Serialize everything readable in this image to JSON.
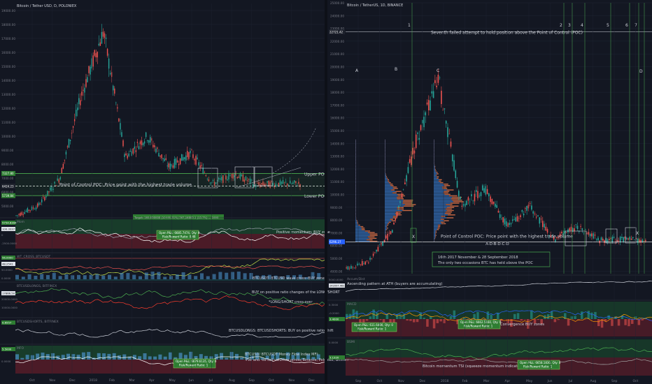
{
  "left": {
    "header": "Bitcoin / Tether USD, D, POLONIEX",
    "y_ticks": [
      "19000.00",
      "18000.00",
      "17000.00",
      "16000.00",
      "15000.00",
      "14000.00",
      "13000.00",
      "12000.00",
      "11000.00",
      "10000.00",
      "9000.00",
      "8000.00",
      "7000.00",
      "6000.00",
      "5000.00"
    ],
    "y_tick_values": [
      19000,
      18000,
      17000,
      16000,
      15000,
      14000,
      13000,
      12000,
      11000,
      10000,
      9000,
      8000,
      7000,
      6000,
      5000
    ],
    "price_tags": [
      {
        "text": "7327.80",
        "color": "#2e7d32"
      },
      {
        "text": "6424.23",
        "color": "#1e222d"
      },
      {
        "text": "5739.84",
        "color": "#2e7d32"
      }
    ],
    "labels": {
      "upper_poc": "Upper POC",
      "poc": "Point of Control POC: Price point with the highest trade volume",
      "lower_poc": "Lower POC",
      "target": "Target: 169.538088 (10445.31%) 367,16883.1 (13.7%) ... 1990"
    },
    "panes": [
      {
        "title": "Mom",
        "readout": "100.3337",
        "tag": "5754.6394",
        "side": "Positive momentum: BUY zone",
        "ticks": [
          "0",
          "-2500.0000"
        ],
        "pnl": [
          "Open P&L: 6685.7474, Qty: 0",
          "Risk/Reward Ratio: 0.48"
        ]
      },
      {
        "title": "WT_CROSS_BTCUSDT",
        "readout": "48.2541",
        "tag": "56.0000",
        "side": "BTCUSDT: BTCUSD wave cross: BUY zone",
        "ticks": [
          "50.0000",
          "0.0000"
        ]
      },
      {
        "title": "BTCUSDLONGS, BITFINEX",
        "readout": "17866.50",
        "tag": "",
        "side": "BUY on positive ratio changes of the LONG/SHORT",
        "side2": "*LONG/SHORT cross over",
        "ticks": [
          "20000.0000",
          "10000.0000"
        ]
      },
      {
        "title": "BTCUSDSHORTS, BITFINEX",
        "readout": "",
        "tag": "0.6557",
        "side": "BTCUSDLONGS: BTCUSDSHORTS: BUY on positive ratio shift",
        "ticks": []
      },
      {
        "title": "MFO",
        "readout": "",
        "tag": "5.5000",
        "side": "BTCUSD/ BTCUSDT Money Flow Index MFI:",
        "side2": "+ve and -ve sell volumes across Binance, Poloniex, Bitfinex",
        "ticks": [
          "0.0000"
        ],
        "pnl": [
          "Open P&L: 6679.6135, Qty: 0",
          "Risk/Reward Ratio: 1"
        ]
      }
    ],
    "x_ticks": [
      "Oct",
      "Nov",
      "Dec",
      "2018",
      "Feb",
      "Mar",
      "Apr",
      "May",
      "Jun",
      "Jul",
      "Aug",
      "Sep",
      "Oct",
      "Nov",
      "Dec"
    ]
  },
  "right": {
    "header": "Bitcoin / TetherUS, 1D, BINANCE",
    "y_ticks": [
      "25000.00",
      "24000.00",
      "23000.00",
      "22000.00",
      "21000.00",
      "20000.00",
      "19000.00",
      "18000.00",
      "17000.00",
      "16000.00",
      "15000.00",
      "14000.00",
      "13000.00",
      "12000.00",
      "11000.00",
      "10000.00",
      "9000.00",
      "8000.00",
      "7000.00",
      "6000.00",
      "5000.00",
      "4000.00"
    ],
    "y_tick_values": [
      25000,
      24000,
      23000,
      22000,
      21000,
      20000,
      19000,
      18000,
      17000,
      16000,
      15000,
      14000,
      13000,
      12000,
      11000,
      10000,
      9000,
      8000,
      7000,
      6000,
      5000,
      4000
    ],
    "price_tags": [
      {
        "text": "22721.42",
        "color": "#1e222d"
      },
      {
        "text": "6296.27",
        "color": "#2962ff"
      }
    ],
    "markers": [
      "1",
      "2",
      "3",
      "4",
      "5",
      "6",
      "7"
    ],
    "letters": [
      "A",
      "B",
      "C",
      "D"
    ],
    "x_labels": {
      "bottom": "A-D-B-D-C-D",
      "box_x1": "X",
      "box_x2": "X"
    },
    "labels": {
      "seventh": "Seventh failed attempt to hold position above the Point of Control (POC)",
      "poc": "Point of Control POC: Price point with the highest trade volume",
      "note1": "16th 2017 November & 28 September 2018",
      "note2": "The only two occasions BTC has held above the POC"
    },
    "panes": [
      {
        "title": "Accum/Dist",
        "readout": "242097.4611",
        "tag": "",
        "side": "Ascending pattern at ATH (buyers are accumulating)",
        "ticks": [
          "5000.0000"
        ]
      },
      {
        "title": "MACD",
        "readout": "",
        "tag": "3.4000",
        "side": "Convergence BUY zones",
        "ticks": [
          "0.3000",
          "-0.2000"
        ],
        "pnl": [
          "Open P&L: 6662.5160, Qty: 0",
          "Risk/Reward Ratio: 1"
        ],
        "pnl2": [
          "Open P&L: 611.6400, Qty: 0",
          "Risk/Reward Ratio: 1"
        ]
      },
      {
        "title": "BSMI",
        "readout": "",
        "tag": "3.1320",
        "side": "Bitcoin momentum TSI (squeeze momentum indicator): Bull... reached.",
        "ticks": [
          "0.0000"
        ],
        "pnl": [
          "Open P&L: 6658.1830, Qty: 0",
          "Risk/Reward Ratio: 1"
        ]
      }
    ],
    "x_ticks": [
      "Sep",
      "Oct",
      "Nov",
      "Dec",
      "2018",
      "Feb",
      "Mar",
      "Apr",
      "May",
      "Jun",
      "Jul",
      "Aug",
      "Sep",
      "Oct"
    ]
  },
  "chart_data": [
    {
      "type": "line",
      "title": "Bitcoin / Tether USD, D, POLONIEX",
      "x": [
        "Sep 2017",
        "Oct",
        "Nov",
        "Dec",
        "Jan 2018",
        "Feb",
        "Mar",
        "Apr",
        "May",
        "Jun",
        "Jul",
        "Aug",
        "Sep",
        "Oct"
      ],
      "values": [
        4300,
        5000,
        7000,
        13000,
        17500,
        8500,
        10000,
        7800,
        8800,
        6600,
        7300,
        6500,
        6600,
        6600
      ],
      "ylim": [
        4500,
        19500
      ],
      "series": [
        {
          "name": "Upper POC",
          "values": [
            7327.8
          ]
        },
        {
          "name": "Lower POC",
          "values": [
            5739.84
          ]
        },
        {
          "name": "Point of Control",
          "values": [
            6424.23
          ]
        }
      ]
    },
    {
      "type": "line",
      "title": "Bitcoin / TetherUS, 1D, BINANCE",
      "x": [
        "Sep 2017",
        "Oct",
        "Nov",
        "Dec",
        "Jan 2018",
        "Feb",
        "Mar",
        "Apr",
        "May",
        "Jun",
        "Jul",
        "Aug",
        "Sep",
        "Oct"
      ],
      "values": [
        4200,
        4800,
        7200,
        14000,
        19000,
        9000,
        10500,
        7500,
        9000,
        6500,
        7500,
        6400,
        6500,
        6300
      ],
      "ylim": [
        3800,
        25000
      ],
      "series": [
        {
          "name": "Seventh failed attempt level",
          "values": [
            22721.42
          ]
        },
        {
          "name": "Point of Control",
          "values": [
            6296.27
          ]
        }
      ]
    }
  ],
  "colors": {
    "bg": "#131722",
    "grid": "#1f2533",
    "up": "#26a69a",
    "down": "#ef5350",
    "text": "#d1d4dc",
    "tick": "#787b86",
    "green": "#4caf50",
    "yellow": "#c6e24a",
    "red_zone": "#7a1f2b",
    "green_zone": "#1b4d2e"
  }
}
